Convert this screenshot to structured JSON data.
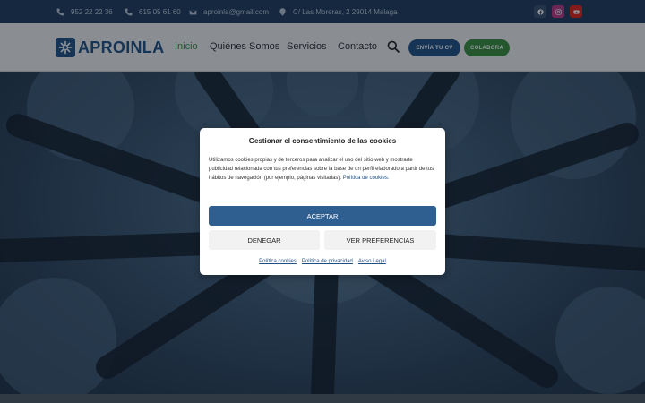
{
  "topbar": {
    "phone1": "952 22 22 36",
    "phone2": "615 05 61 60",
    "email": "aproinla@gmail.com",
    "address": "C/ Las Moreras, 2 29014 Malaga",
    "social": [
      {
        "icon": "facebook-icon",
        "color": "#3a4f6a"
      },
      {
        "icon": "instagram-icon",
        "color": "#c13584"
      },
      {
        "icon": "youtube-icon",
        "color": "#e62117"
      }
    ]
  },
  "header": {
    "logo_text": "APROINLA",
    "nav": [
      "Inicio",
      "Quiénes Somos",
      "Servicios",
      "Contacto"
    ],
    "btn_cv": "ENVÍA TU CV",
    "btn_colabora": "COLABORA"
  },
  "cookie_modal": {
    "title": "Gestionar el consentimiento de las cookies",
    "body": "Utilizamos cookies propias y de terceros para analizar el uso del sitio web y mostrarte publicidad relacionada con tus preferencias sobre la base de un perfil elaborado a partir de tus hábitos de navegación (por ejemplo, páginas visitadas).",
    "body_link": "Política de cookies.",
    "accept": "ACEPTAR",
    "deny": "DENEGAR",
    "preferences": "VER PREFERENCIAS",
    "footer_links": [
      "Política cookies",
      "Política de privacidad",
      "Aviso Legal"
    ]
  },
  "colors": {
    "topbar_bg": "#1e3a5a",
    "brand_blue": "#1f4f82",
    "accent_green": "#3a8e3a",
    "accept_btn": "#2f5f90"
  }
}
